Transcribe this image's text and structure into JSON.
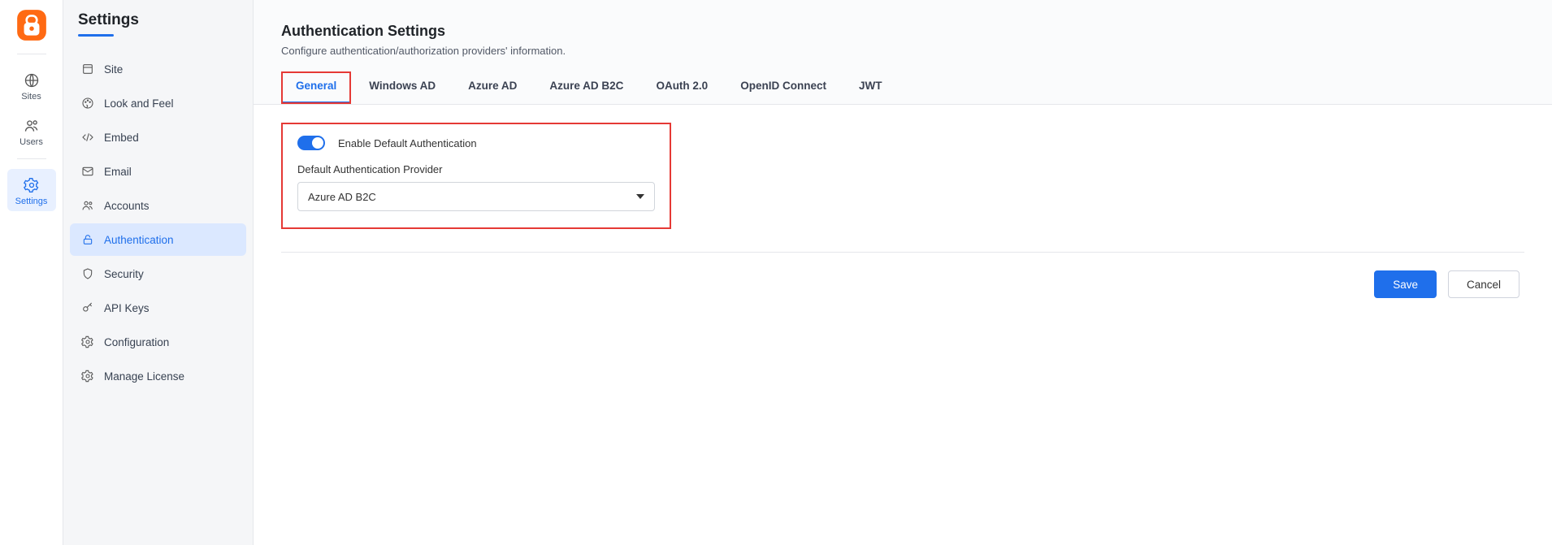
{
  "rail": {
    "items": [
      {
        "label": "Sites"
      },
      {
        "label": "Users"
      },
      {
        "label": "Settings"
      }
    ]
  },
  "sidebar": {
    "title": "Settings",
    "items": [
      {
        "label": "Site"
      },
      {
        "label": "Look and Feel"
      },
      {
        "label": "Embed"
      },
      {
        "label": "Email"
      },
      {
        "label": "Accounts"
      },
      {
        "label": "Authentication"
      },
      {
        "label": "Security"
      },
      {
        "label": "API Keys"
      },
      {
        "label": "Configuration"
      },
      {
        "label": "Manage License"
      }
    ],
    "active_index": 5
  },
  "header": {
    "title": "Authentication Settings",
    "subtitle": "Configure authentication/authorization providers' information."
  },
  "tabs": {
    "items": [
      {
        "label": "General"
      },
      {
        "label": "Windows AD"
      },
      {
        "label": "Azure AD"
      },
      {
        "label": "Azure AD B2C"
      },
      {
        "label": "OAuth 2.0"
      },
      {
        "label": "OpenID Connect"
      },
      {
        "label": "JWT"
      }
    ],
    "active_index": 0
  },
  "general": {
    "enable_default_auth": {
      "label": "Enable Default Authentication",
      "value": true
    },
    "default_provider": {
      "label": "Default Authentication Provider",
      "selected": "Azure AD B2C"
    }
  },
  "footer": {
    "save": "Save",
    "cancel": "Cancel"
  }
}
